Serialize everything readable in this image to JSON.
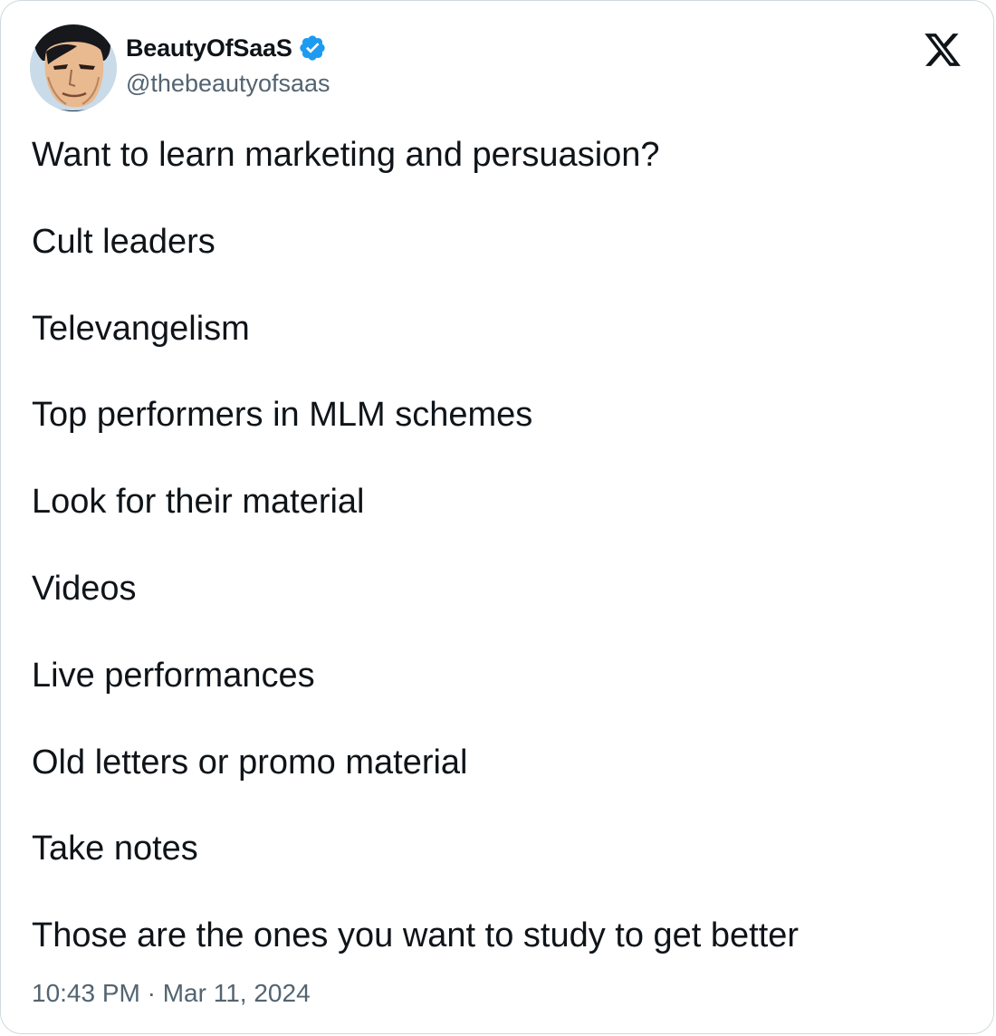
{
  "author": {
    "display_name": "BeautyOfSaaS",
    "handle": "@thebeautyofsaas",
    "verified": true,
    "avatar_icon": "comic-portrait-avatar"
  },
  "brand": {
    "logo_icon": "x-logo-icon",
    "accent_color": "#1d9bf0"
  },
  "tweet": {
    "paragraphs": [
      "Want to learn marketing and persuasion?",
      "Cult leaders",
      "Televangelism",
      "Top performers in MLM schemes",
      "Look for their material",
      "Videos",
      "Live performances",
      "Old letters or promo material",
      "Take notes",
      "Those are the ones you want to study to get better"
    ],
    "timestamp": "10:43 PM · Mar 11, 2024"
  }
}
